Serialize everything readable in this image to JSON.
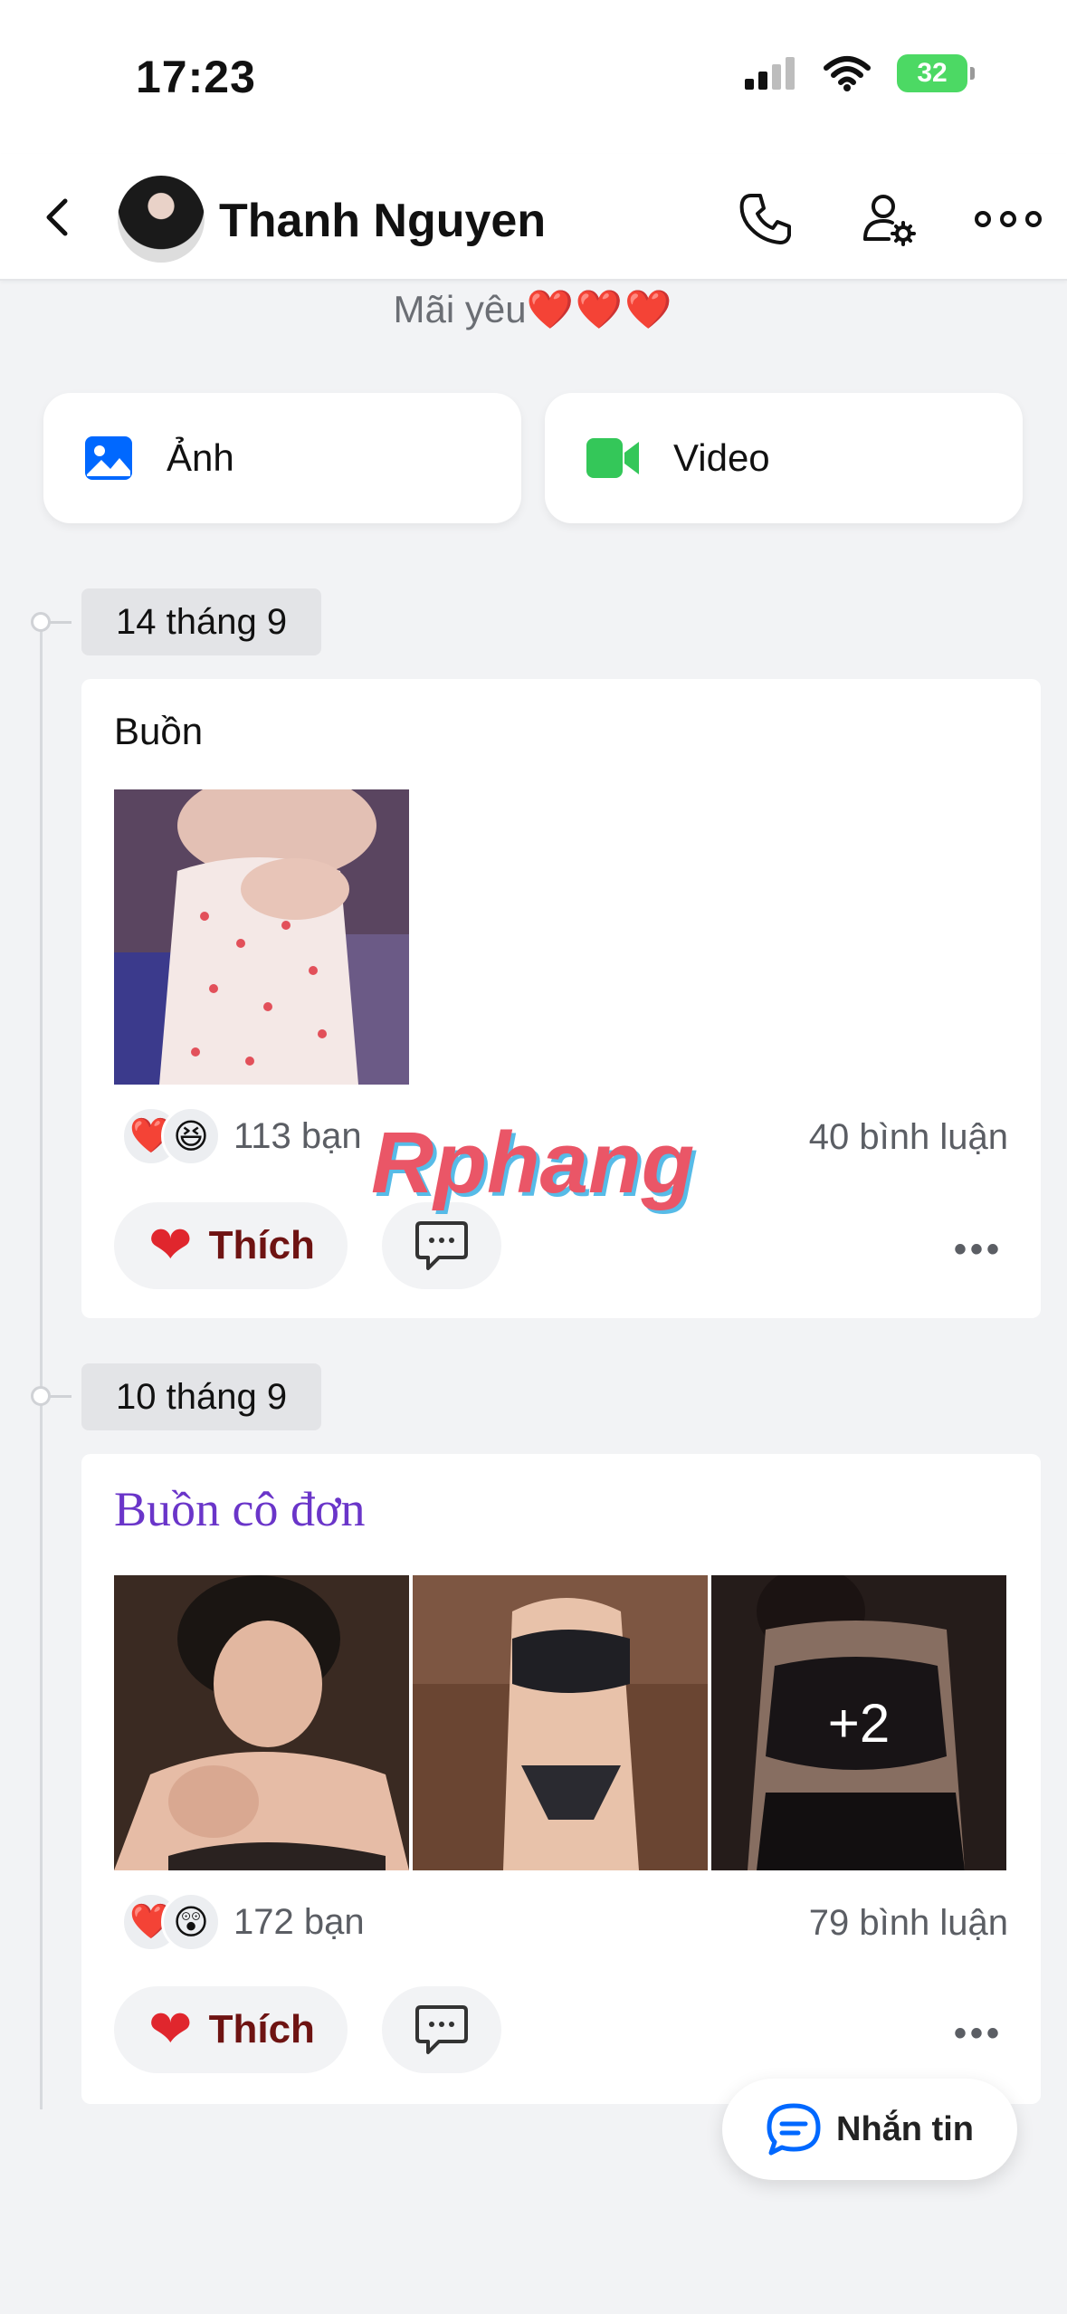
{
  "status_bar": {
    "time": "17:23",
    "battery": "32"
  },
  "header": {
    "name": "Thanh Nguyen"
  },
  "bio": {
    "text": "Mãi yêu",
    "hearts": "❤️❤️❤️"
  },
  "media_buttons": [
    {
      "label": "Ảnh",
      "icon": "photo-icon"
    },
    {
      "label": "Video",
      "icon": "video-icon"
    }
  ],
  "posts": [
    {
      "date": "14 tháng 9",
      "text": "Buồn",
      "reactions": [
        "❤️",
        "😆"
      ],
      "reaction_count": "113 bạn",
      "comment_count": "40 bình luận",
      "like_label": "Thích"
    },
    {
      "date": "10 tháng 9",
      "text": "Buồn cô đơn",
      "reactions": [
        "❤️",
        "😲"
      ],
      "reaction_count": "172 bạn",
      "comment_count": "79 bình luận",
      "like_label": "Thích",
      "extra_photos": "+2"
    }
  ],
  "watermark": "Rphang",
  "chat_button": {
    "label": "Nhắn tin"
  },
  "colors": {
    "accent": "#0068ff",
    "heart": "#e0262d",
    "serif_title": "#6a35c9",
    "video_green": "#34c759"
  }
}
